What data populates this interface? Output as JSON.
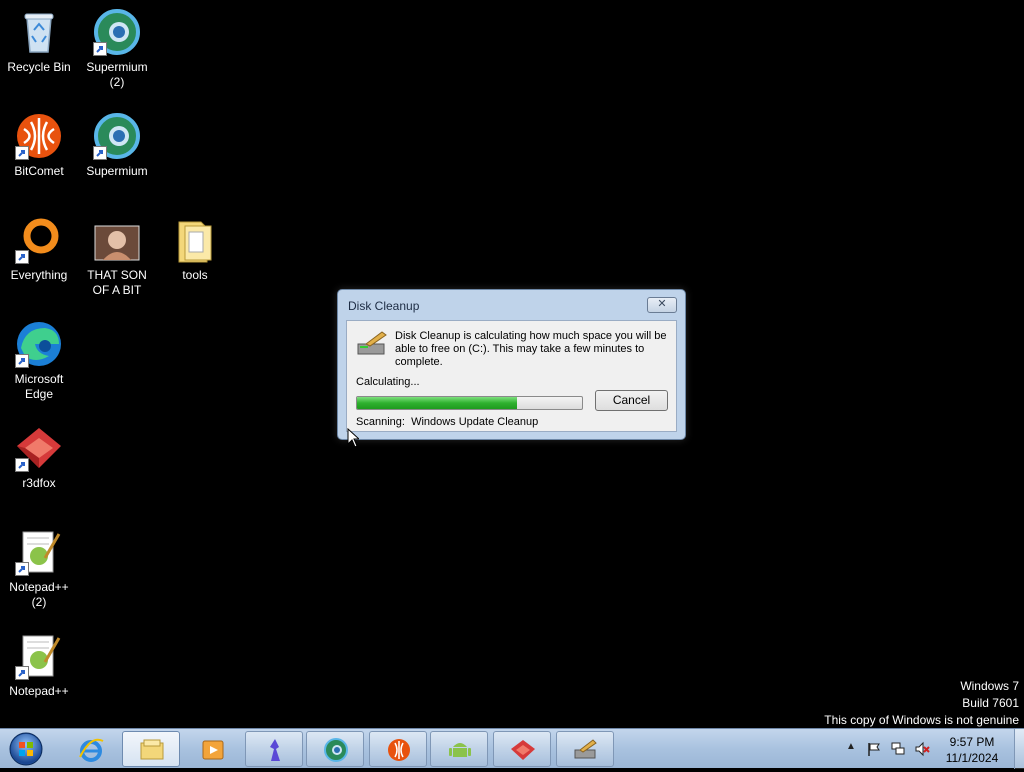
{
  "desktop": {
    "icons": [
      {
        "label": "Recycle Bin"
      },
      {
        "label": "Supermium\n(2)"
      },
      {
        "label": "BitComet"
      },
      {
        "label": "Supermium"
      },
      {
        "label": "Everything"
      },
      {
        "label": "THAT SON\nOF A BIT"
      },
      {
        "label": "tools"
      },
      {
        "label": "Microsoft\nEdge"
      },
      {
        "label": "r3dfox"
      },
      {
        "label": "Notepad++\n(2)"
      },
      {
        "label": "Notepad++"
      }
    ]
  },
  "dialog": {
    "title": "Disk Cleanup",
    "close_label": "✕",
    "message": "Disk Cleanup is calculating how much space you will be able to free on  (C:). This may take a few minutes to complete.",
    "status": "Calculating...",
    "progress_fraction": 0.71,
    "cancel_label": "Cancel",
    "scanning_label": "Scanning:",
    "scanning_item": "Windows Update Cleanup"
  },
  "watermark": {
    "line1": "Windows 7",
    "line2": "Build 7601",
    "line3": "This copy of Windows is not genuine"
  },
  "taskbar": {
    "pinned": [
      "start-orb",
      "internet-explorer",
      "windows-explorer",
      "media-player",
      "app-blue-figure",
      "supermium",
      "bitcomet",
      "android",
      "r3dfox",
      "disk-cleanup"
    ],
    "tray": {
      "time": "9:57 PM",
      "date": "11/1/2024",
      "show_hidden": "▲"
    }
  },
  "colors": {
    "progress": "#2fb12f",
    "taskbar": "#b2c8e3",
    "dialog_frame": "#bfd3ea"
  }
}
